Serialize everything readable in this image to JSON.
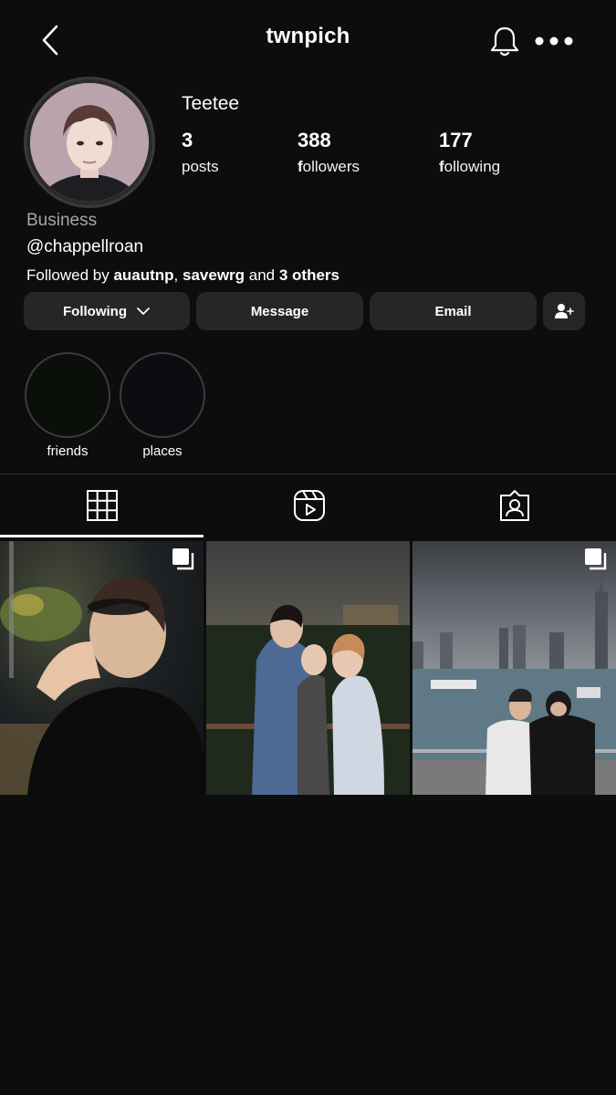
{
  "header": {
    "username": "twnpich",
    "back_icon": "chevron-left-icon",
    "bell_icon": "bell-icon",
    "more_icon": "more-horizontal-icon"
  },
  "profile": {
    "display_name": "Teetee",
    "category": "Business",
    "handle": "@chappellroan",
    "stats": [
      {
        "value": "3",
        "label": "posts"
      },
      {
        "value": "388",
        "label_first": "f",
        "label_rest": "ollowers"
      },
      {
        "value": "177",
        "label_first": "f",
        "label_rest": "ollowing"
      }
    ],
    "followed_by": {
      "prefix": "Followed by ",
      "user1": "auautnp",
      "sep": ", ",
      "user2": "savewrg",
      "and": " and ",
      "others": "3 others"
    }
  },
  "actions": {
    "following": "Following",
    "message": "Message",
    "email": "Email",
    "add_user_icon": "person-add-icon"
  },
  "highlights": [
    {
      "label": "friends"
    },
    {
      "label": "places"
    }
  ],
  "tabs": [
    {
      "icon": "grid-icon",
      "active": true
    },
    {
      "icon": "reels-icon",
      "active": false
    },
    {
      "icon": "tagged-icon",
      "active": false
    }
  ],
  "posts": [
    {
      "multi": true
    },
    {
      "multi": false
    },
    {
      "multi": true
    }
  ],
  "colors": {
    "background": "#0d0d0d",
    "button": "#262626",
    "text": "#ffffff",
    "muted": "#a6a6a6"
  }
}
